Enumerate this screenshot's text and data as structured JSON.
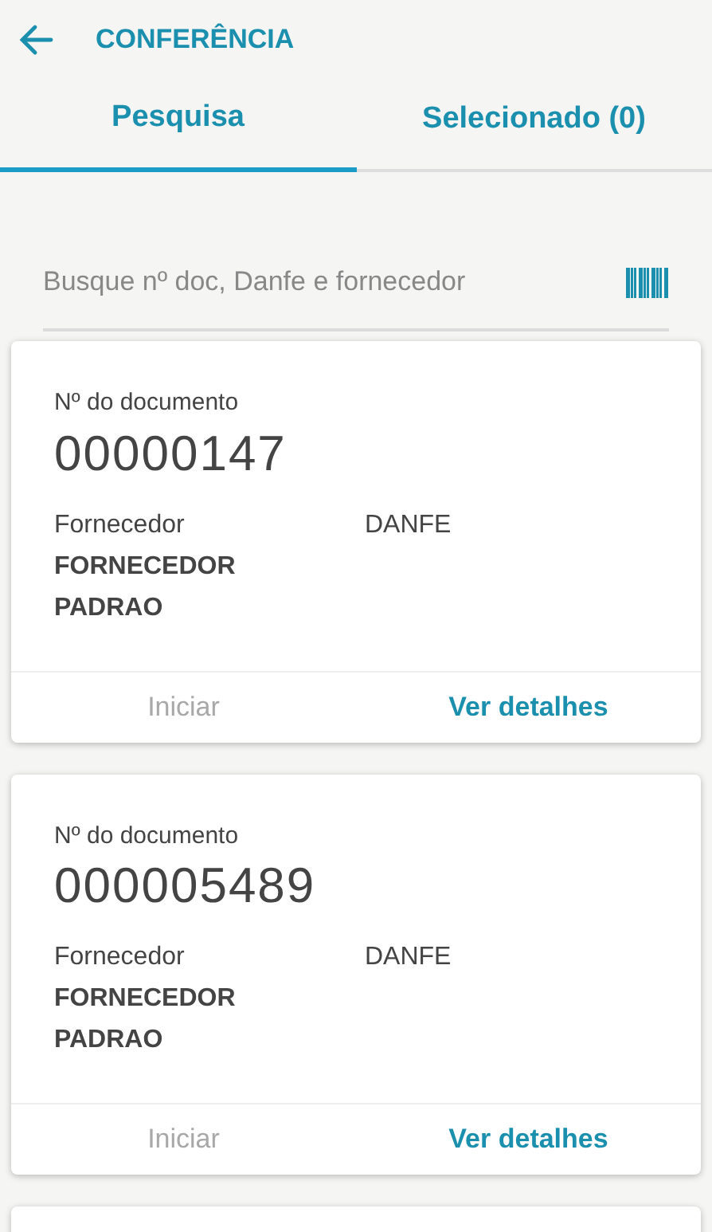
{
  "header": {
    "title": "CONFERÊNCIA"
  },
  "tabs": [
    {
      "label": "Pesquisa",
      "selected": true
    },
    {
      "label": "Selecionado (0)",
      "selected": false
    }
  ],
  "search": {
    "placeholder": "Busque nº doc, Danfe e fornecedor"
  },
  "documents": [
    {
      "doc_label": "Nº do documento",
      "doc_number": "00000147",
      "supplier_label": "Fornecedor",
      "supplier": "FORNECEDOR PADRAO",
      "danfe_label": "DANFE",
      "start": {
        "label": "Iniciar",
        "disabled": true
      },
      "details": {
        "label": "Ver detalhes"
      }
    },
    {
      "doc_label": "Nº do documento",
      "doc_number": "000005489",
      "supplier_label": "Fornecedor",
      "supplier": "FORNECEDOR PADRAO",
      "danfe_label": "DANFE",
      "start": {
        "label": "Iniciar",
        "disabled": true
      },
      "details": {
        "label": "Ver detalhes"
      }
    }
  ]
}
